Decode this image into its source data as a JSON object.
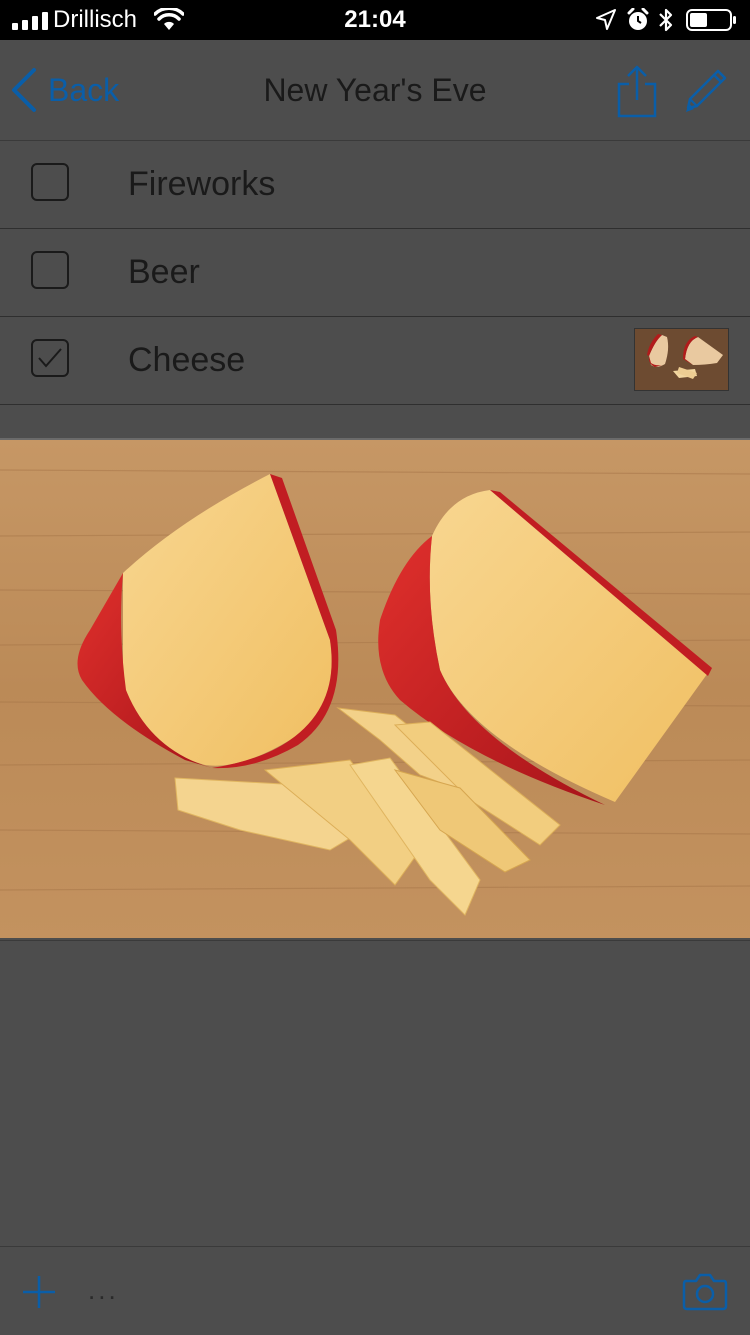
{
  "status_bar": {
    "carrier": "Drillisch",
    "time": "21:04"
  },
  "nav": {
    "back_label": "Back",
    "title": "New Year's Eve",
    "icons": [
      "chevron-left-icon",
      "share-icon",
      "pencil-icon"
    ]
  },
  "items": [
    {
      "label": "Fireworks",
      "checked": false
    },
    {
      "label": "Beer",
      "checked": false
    },
    {
      "label": "Cheese",
      "checked": true
    }
  ],
  "toolbar": {
    "more_label": "...",
    "icons": [
      "plus-icon",
      "camera-icon"
    ]
  },
  "colors": {
    "accent": "#0a5ea8",
    "background": "#4d4d4d",
    "text": "#1a1a1a"
  }
}
